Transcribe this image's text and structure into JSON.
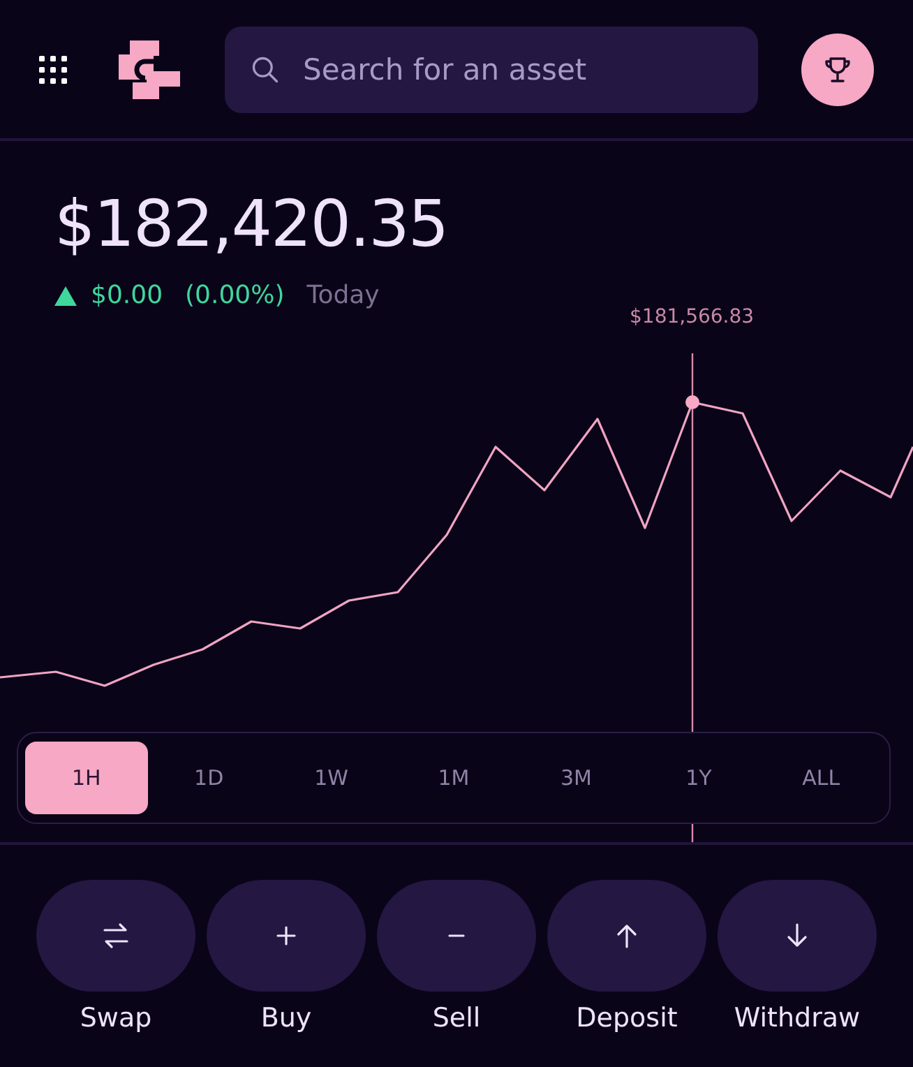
{
  "search": {
    "placeholder": "Search for an asset"
  },
  "balance": {
    "value": "$182,420.35",
    "change": "$0.00",
    "percent": "(0.00%)",
    "period": "Today",
    "rising": true
  },
  "chart": {
    "hover_value": "$181,566.83"
  },
  "periods": [
    {
      "label": "1H",
      "selected": true
    },
    {
      "label": "1D",
      "selected": false
    },
    {
      "label": "1W",
      "selected": false
    },
    {
      "label": "1M",
      "selected": false
    },
    {
      "label": "3M",
      "selected": false
    },
    {
      "label": "1Y",
      "selected": false
    },
    {
      "label": "ALL",
      "selected": false
    }
  ],
  "actions": [
    {
      "label": "Swap",
      "kind": "swap"
    },
    {
      "label": "Buy",
      "kind": "plus"
    },
    {
      "label": "Sell",
      "kind": "minus"
    },
    {
      "label": "Deposit",
      "kind": "up"
    },
    {
      "label": "Withdraw",
      "kind": "down"
    }
  ]
}
